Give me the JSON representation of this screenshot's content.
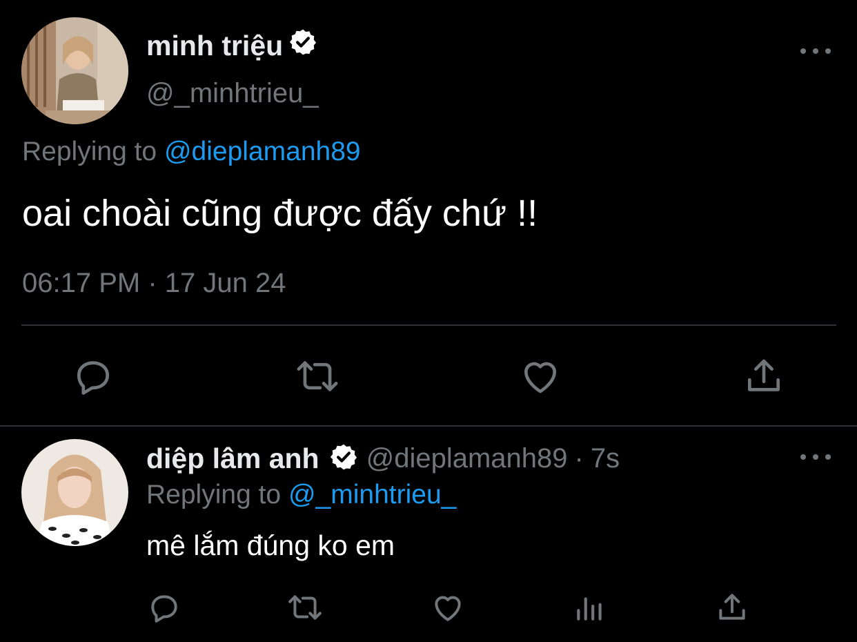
{
  "main_tweet": {
    "author_name": "minh triệu",
    "author_handle": "@_minhtrieu_",
    "verified_icon": "verified-badge-icon",
    "reply_prefix": "Replying to",
    "reply_to": "@dieplamanh89",
    "text": "oai choài cũng được đấy chứ !!",
    "timestamp": "06:17 PM · 17 Jun 24",
    "actions": [
      "reply-icon",
      "retweet-icon",
      "like-icon",
      "share-icon"
    ]
  },
  "reply_tweet": {
    "author_name": "diệp lâm anh",
    "author_handle": "@dieplamanh89",
    "separator": "·",
    "time_ago": "7s",
    "verified_icon": "verified-badge-icon",
    "reply_prefix": "Replying to",
    "reply_to": "@_minhtrieu_",
    "text": "mê lắm đúng ko em",
    "actions": [
      "reply-icon",
      "retweet-icon",
      "like-icon",
      "analytics-icon",
      "share-icon"
    ]
  },
  "colors": {
    "background": "#000000",
    "text_primary": "#e7e9ea",
    "text_secondary": "#71767b",
    "accent": "#1d9bf0",
    "divider": "#2f3336"
  }
}
